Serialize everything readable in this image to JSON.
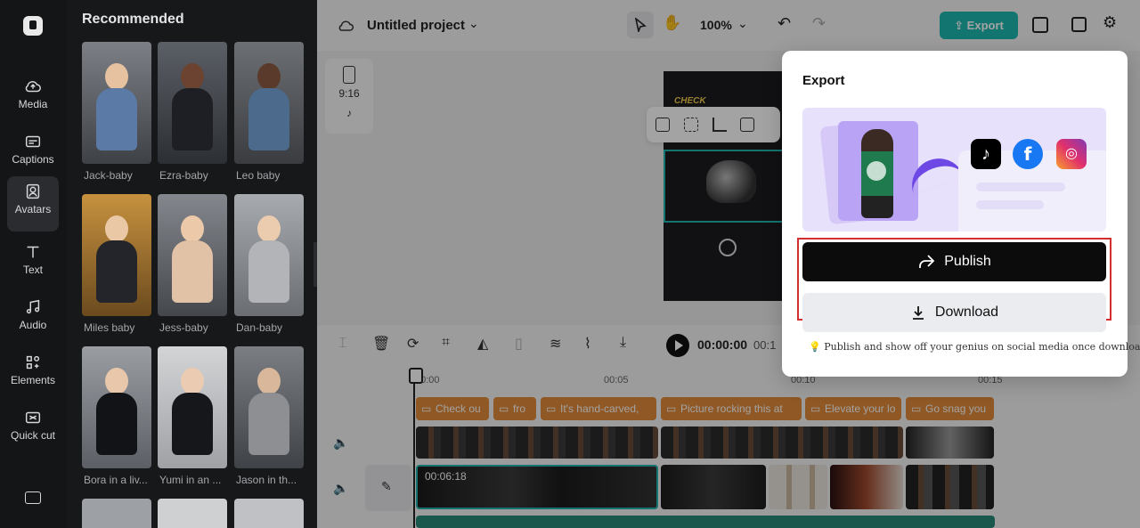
{
  "rail": {
    "items": [
      {
        "label": "Media",
        "icon": "cloud-upload-icon"
      },
      {
        "label": "Captions",
        "icon": "captions-icon"
      },
      {
        "label": "Avatars",
        "icon": "avatar-icon"
      },
      {
        "label": "Text",
        "icon": "text-icon"
      },
      {
        "label": "Audio",
        "icon": "music-note-icon"
      },
      {
        "label": "Elements",
        "icon": "elements-icon"
      },
      {
        "label": "Quick cut",
        "icon": "quick-cut-icon"
      }
    ],
    "active": "Avatars"
  },
  "panel": {
    "title": "Recommended",
    "avatars": [
      {
        "name": "Jack-baby"
      },
      {
        "name": "Ezra-baby"
      },
      {
        "name": "Leo baby"
      },
      {
        "name": "Miles baby"
      },
      {
        "name": "Jess-baby"
      },
      {
        "name": "Dan-baby"
      },
      {
        "name": "Bora in a liv..."
      },
      {
        "name": "Yumi in an ..."
      },
      {
        "name": "Jason in th..."
      }
    ]
  },
  "topbar": {
    "project_name": "Untitled project",
    "zoom": "100%",
    "export_label": "Export"
  },
  "ratio": {
    "label": "9:16"
  },
  "canvas": {
    "overlay_text": "CHECK"
  },
  "timeline": {
    "current_time": "00:00:00",
    "total_time_fragment": "00:1",
    "ruler": [
      "00:00",
      "00:05",
      "00:10",
      "00:15"
    ],
    "captions": [
      "Check ou",
      "fro",
      "It's hand-carved,",
      "Picture rocking this at",
      "Elevate your lo",
      "Go snag you"
    ],
    "selected_clip_time": "00:06:18"
  },
  "export_dialog": {
    "title": "Export",
    "publish_label": "Publish",
    "download_label": "Download",
    "hint": "Publish and show off your genius on social media once downloaded.",
    "social": [
      "tiktok",
      "facebook",
      "instagram"
    ],
    "colors": {
      "publish_bg": "#0c0c0c",
      "download_bg": "#ebecef",
      "accent": "#6d48e5",
      "highlight": "#d32f2f"
    }
  }
}
